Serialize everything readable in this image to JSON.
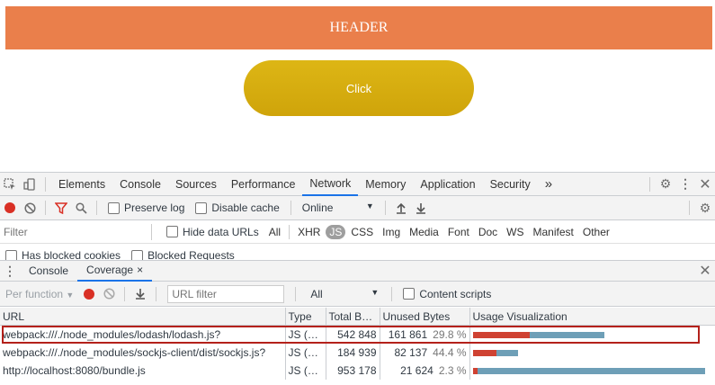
{
  "page": {
    "header": "HEADER",
    "button": "Click"
  },
  "devtools": {
    "tabs": [
      "Elements",
      "Console",
      "Sources",
      "Performance",
      "Network",
      "Memory",
      "Application",
      "Security"
    ],
    "active_tab": "Network",
    "more_tabs": "»",
    "network_toolbar": {
      "preserve_log": "Preserve log",
      "disable_cache": "Disable cache",
      "throttle": "Online"
    },
    "filter": {
      "placeholder": "Filter",
      "hide_data_urls": "Hide data URLs",
      "types": [
        "All",
        "XHR",
        "JS",
        "CSS",
        "Img",
        "Media",
        "Font",
        "Doc",
        "WS",
        "Manifest",
        "Other"
      ],
      "active_type": "JS",
      "has_blocked_cookies": "Has blocked cookies",
      "blocked_requests": "Blocked Requests"
    },
    "drawer": {
      "tabs": [
        "Console",
        "Coverage"
      ],
      "active_tab": "Coverage",
      "close_glyph": "×"
    },
    "coverage": {
      "per_function": "Per function",
      "url_filter_placeholder": "URL filter",
      "type_filter": "All",
      "content_scripts": "Content scripts",
      "columns": [
        "URL",
        "Type",
        "Total B…",
        "Unused Bytes",
        "Usage Visualization"
      ],
      "rows": [
        {
          "url": "webpack:///./node_modules/lodash/lodash.js?",
          "type": "JS (…",
          "total": "542 848",
          "unused": "161 861",
          "pct": "29.8 %",
          "used_fraction": 0.702,
          "total_fraction": 0.569
        },
        {
          "url": "webpack:///./node_modules/sockjs-client/dist/sockjs.js?",
          "type": "JS (…",
          "total": "184 939",
          "unused": "82 137",
          "pct": "44.4 %",
          "used_fraction": 0.556,
          "total_fraction": 0.194
        },
        {
          "url": "http://localhost:8080/bundle.js",
          "type": "JS (…",
          "total": "953 178",
          "unused": "21 624",
          "pct": "2.3 %",
          "used_fraction": 0.977,
          "total_fraction": 1.0
        }
      ]
    }
  },
  "colors": {
    "header_bg": "#ea7f4b",
    "button_bg": "#d9b012",
    "used_bar": "#cf4232",
    "unused_bar": "#6e9fb7",
    "highlight": "#b4211b"
  }
}
